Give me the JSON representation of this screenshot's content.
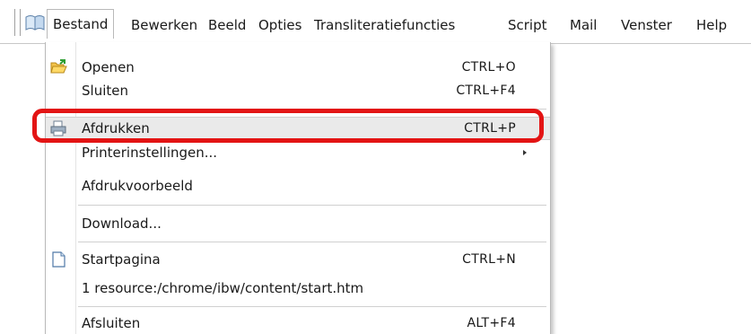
{
  "menubar": {
    "items": [
      {
        "label": "Bestand"
      },
      {
        "label": "Bewerken"
      },
      {
        "label": "Beeld"
      },
      {
        "label": "Opties"
      },
      {
        "label": "Transliteratiefuncties"
      },
      {
        "label": "Script"
      },
      {
        "label": "Mail"
      },
      {
        "label": "Venster"
      },
      {
        "label": "Help"
      }
    ],
    "active": "Bestand"
  },
  "file_menu": {
    "items": [
      {
        "label": "Openen",
        "shortcut": "CTRL+O",
        "icon": "folder-open-icon"
      },
      {
        "label": "Sluiten",
        "shortcut": "CTRL+F4"
      },
      {
        "label": "Afdrukken",
        "shortcut": "CTRL+P",
        "icon": "printer-icon",
        "highlighted": true
      },
      {
        "label": "Printerinstellingen...",
        "has_submenu": true
      },
      {
        "label": "Afdrukvoorbeeld"
      },
      {
        "label": "Download..."
      },
      {
        "label": "Startpagina",
        "shortcut": "CTRL+N",
        "icon": "page-icon"
      },
      {
        "label": "1 resource:/chrome/ibw/content/start.htm"
      },
      {
        "label": "Afsluiten",
        "shortcut": "ALT+F4"
      }
    ]
  },
  "colors": {
    "highlight_frame": "#e31414",
    "highlight_row": "#eaeaea"
  }
}
